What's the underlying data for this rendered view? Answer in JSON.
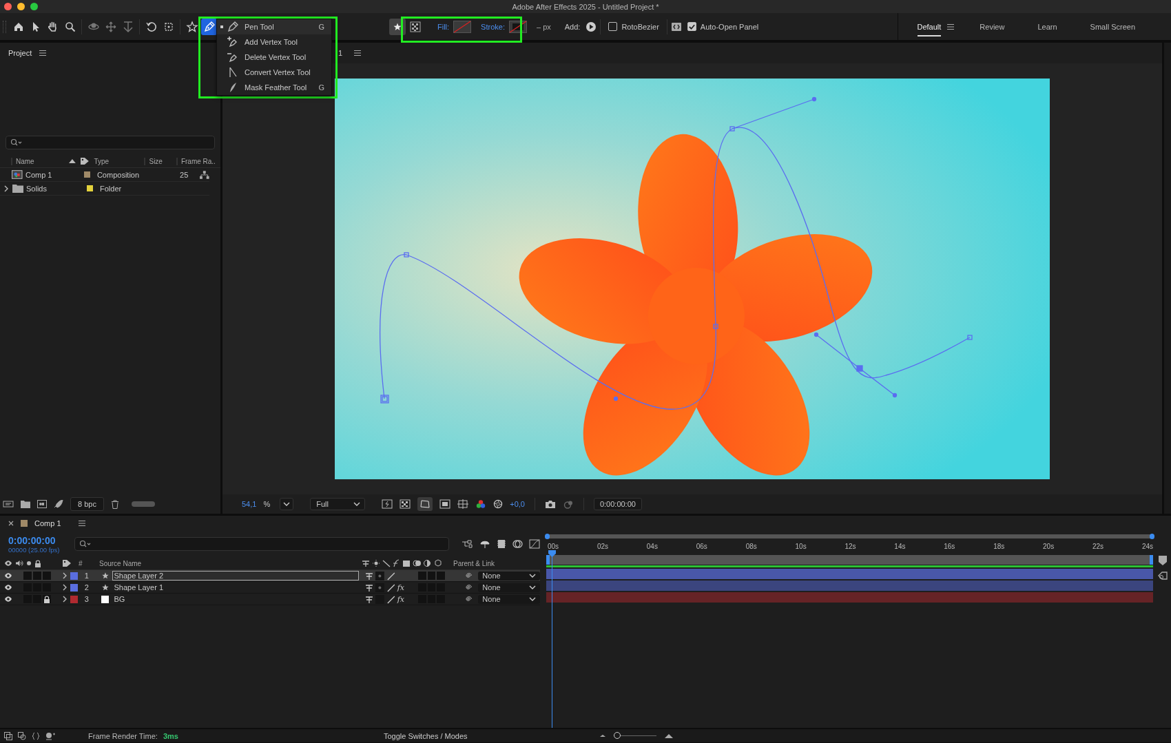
{
  "window": {
    "title": "Adobe After Effects 2025 - Untitled Project *"
  },
  "toolbar": {
    "tools": [
      {
        "kind": "home",
        "selected": false
      },
      {
        "kind": "pointer",
        "selected": false
      },
      {
        "kind": "hand",
        "selected": false
      },
      {
        "kind": "search",
        "selected": false
      },
      {
        "kind": "orbit",
        "selected": false
      },
      {
        "kind": "move",
        "selected": false
      },
      {
        "kind": "dolly",
        "selected": false
      },
      {
        "kind": "rotate",
        "selected": false
      },
      {
        "kind": "frame",
        "selected": false
      },
      {
        "kind": "star",
        "selected": false
      },
      {
        "kind": "pen",
        "selected": true
      }
    ],
    "fill_label": "Fill:",
    "stroke_label": "Stroke:",
    "stroke_width": "– px",
    "add_label": "Add:",
    "rotobezier": {
      "label": "RotoBezier",
      "checked": false
    },
    "auto_open": {
      "label": "Auto-Open Panel",
      "checked": true
    }
  },
  "workspaces": [
    {
      "label": "Default",
      "selected": true
    },
    {
      "label": "Review",
      "selected": false
    },
    {
      "label": "Learn",
      "selected": false
    },
    {
      "label": "Small Screen",
      "selected": false
    }
  ],
  "pen_menu": [
    {
      "kind": "pen",
      "label": "Pen Tool",
      "shortcut": "G",
      "selected": true
    },
    {
      "kind": "add",
      "label": "Add Vertex Tool",
      "selected": false
    },
    {
      "kind": "delete",
      "label": "Delete Vertex Tool",
      "selected": false
    },
    {
      "kind": "convert",
      "label": "Convert Vertex Tool",
      "selected": false
    },
    {
      "kind": "feather",
      "label": "Mask Feather Tool",
      "shortcut": "G",
      "selected": false
    }
  ],
  "project": {
    "title": "Project",
    "columns": [
      "Name",
      "Type",
      "Size",
      "Frame Ra.."
    ],
    "rows": [
      {
        "kind": "composition",
        "name": "Comp 1",
        "color": "#a08a68",
        "type": "Composition",
        "frame_rate": "25"
      },
      {
        "kind": "folder",
        "name": "Solids",
        "color": "#e3d23c",
        "type": "Folder"
      }
    ],
    "bpc": "8 bpc"
  },
  "viewer": {
    "tab_label": "1",
    "zoom": "54,1",
    "zoom_unit": "%",
    "resolution": "Full",
    "exposure": "+0,0",
    "timecode": "0:00:00:00"
  },
  "timeline": {
    "tab": "Comp 1",
    "timecode": "0:00:00:00",
    "frames": "00000 (25.00 fps)",
    "col_number": "#",
    "col_source": "Source Name",
    "col_parent": "Parent & Link",
    "ruler": [
      "00s",
      "02s",
      "04s",
      "06s",
      "08s",
      "10s",
      "12s",
      "14s",
      "16s",
      "18s",
      "20s",
      "22s",
      "24s"
    ],
    "layers": [
      {
        "number": "1",
        "name": "Shape Layer 2",
        "kind": "shape",
        "color": "#5a6ee0",
        "selected": true,
        "locked": false,
        "parent": "None"
      },
      {
        "number": "2",
        "name": "Shape Layer 1",
        "kind": "shape",
        "color": "#5a6ee0",
        "selected": false,
        "locked": false,
        "fx": "fx",
        "parent": "None"
      },
      {
        "number": "3",
        "name": "BG",
        "kind": "solid",
        "color": "#b02a30",
        "selected": false,
        "locked": true,
        "fx": "fx",
        "parent": "None"
      }
    ]
  },
  "status": {
    "render_label": "Frame Render Time:",
    "render_value": "3ms",
    "toggle": "Toggle Switches / Modes",
    "zoom_slider": {
      "level": 0.1
    }
  }
}
